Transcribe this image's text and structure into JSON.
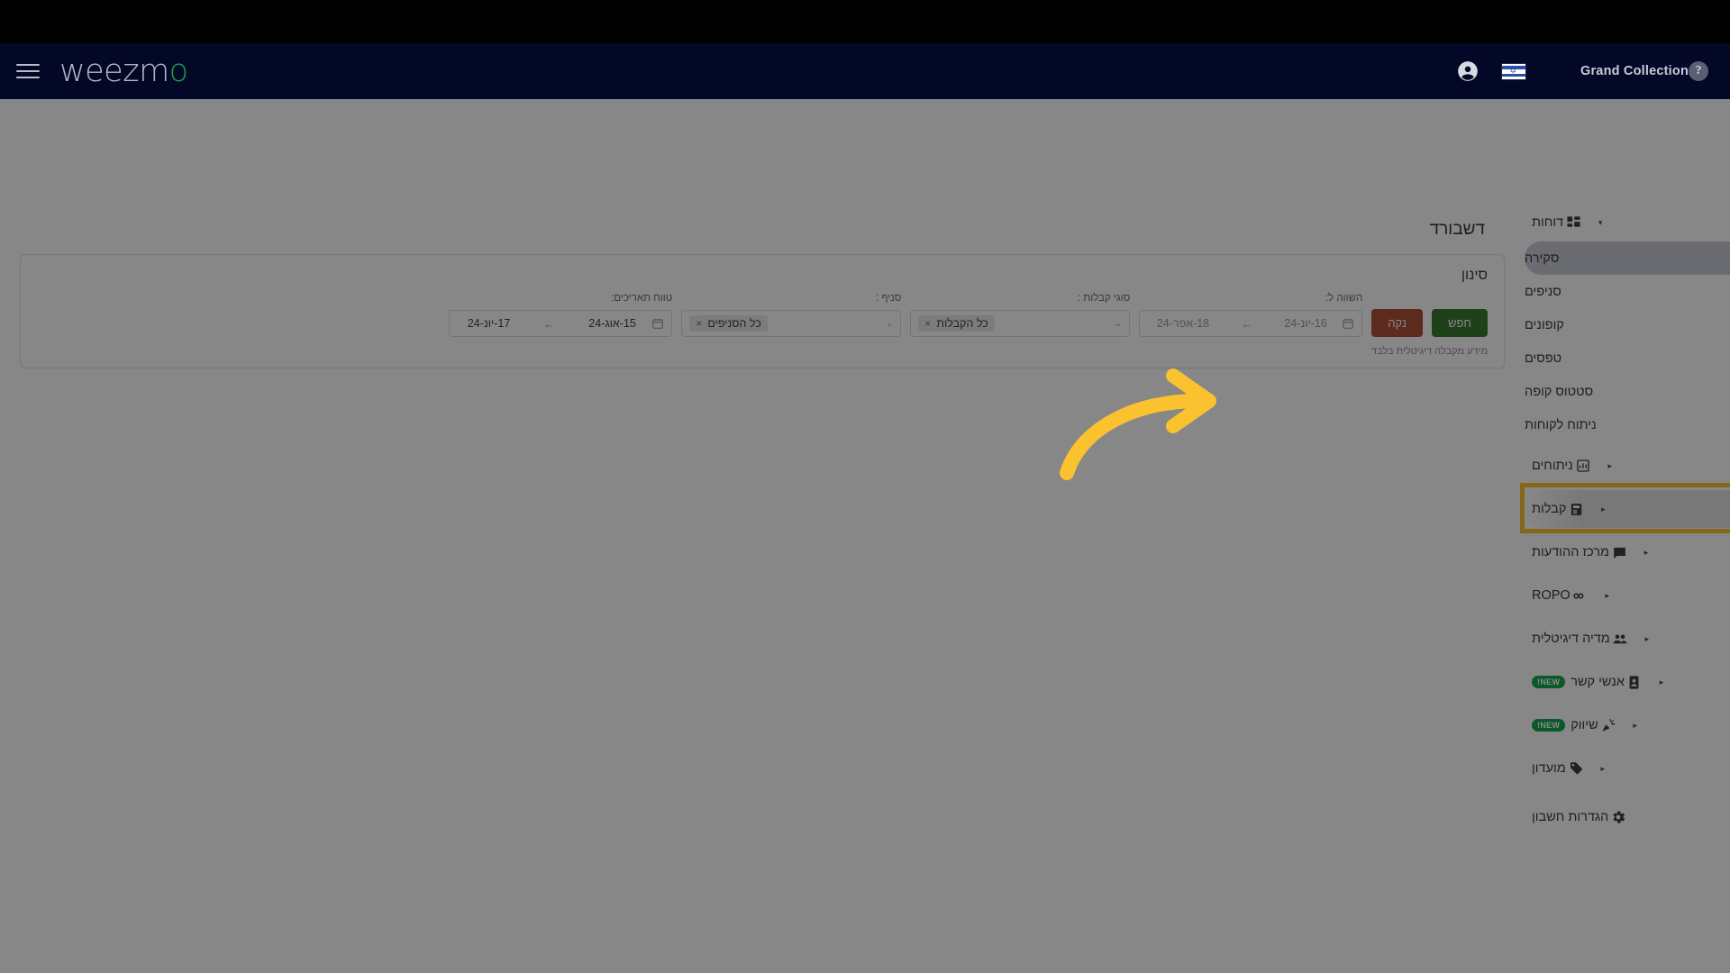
{
  "topbar": {
    "account_icon": "account-circle-icon",
    "flag": "israel-flag-icon",
    "brand_name": "Grand Collection",
    "help_icon": "help-icon",
    "menu_icon": "hamburger-menu-icon",
    "logo_text": "weezm",
    "logo_accent": "o"
  },
  "sidebar": {
    "reports": {
      "label": "דוחות",
      "icon": "dashboard-grid-icon",
      "caret": "▾"
    },
    "report_items": [
      {
        "label": "סקירה",
        "active": true
      },
      {
        "label": "סניפים",
        "active": false
      },
      {
        "label": "קופונים",
        "active": false
      },
      {
        "label": "טפסים",
        "active": false
      },
      {
        "label": "סטטוס קופה",
        "active": false
      },
      {
        "label": "ניתוח לקוחות",
        "active": false
      }
    ],
    "groups": [
      {
        "label": "ניתוחים",
        "icon": "bar-chart-icon",
        "caret": "▸",
        "badge": "",
        "highlighted": false
      },
      {
        "label": "קבלות",
        "icon": "receipt-icon",
        "caret": "▸",
        "badge": "",
        "highlighted": true
      },
      {
        "label": "מרכז ההודעות",
        "icon": "message-icon",
        "caret": "▸",
        "badge": "",
        "highlighted": false
      },
      {
        "label": "ROPO",
        "icon": "infinity-icon",
        "caret": "▸",
        "badge": "",
        "highlighted": false
      },
      {
        "label": "מדיה דיגיטלית",
        "icon": "people-icon",
        "caret": "▸",
        "badge": "",
        "highlighted": false
      },
      {
        "label": "אנשי קשר",
        "icon": "contacts-icon",
        "caret": "▸",
        "badge": "NEW!",
        "highlighted": false
      },
      {
        "label": "שיווק",
        "icon": "megaphone-icon",
        "caret": "▸",
        "badge": "NEW!",
        "highlighted": false
      },
      {
        "label": "מועדון",
        "icon": "tag-icon",
        "caret": "▸",
        "badge": "",
        "highlighted": false
      }
    ],
    "settings": {
      "label": "הגדרות חשבון",
      "icon": "gear-icon"
    }
  },
  "main": {
    "page_title": "דשבורד",
    "filter_card": {
      "title": "סינון",
      "note": "מידע מקבלה דיגיטלית בלבד",
      "date_range": {
        "label": "טווח תאריכים:",
        "start": "17-יונ-24",
        "end": "15-אוג-24",
        "separator": "←",
        "icon": "calendar-icon"
      },
      "branch": {
        "label": "סניף :",
        "chip": "כל הסניפים",
        "chip_remove": "×",
        "chevron": "⌄"
      },
      "receipt_types": {
        "label": "סוגי קבלות :",
        "chip": "כל הקבלות",
        "chip_remove": "×",
        "chevron": "⌄"
      },
      "compare_to": {
        "label": "השווה ל:",
        "start": "18-אפר-24",
        "end": "16-יונ-24",
        "separator": "←",
        "icon": "calendar-icon"
      },
      "clear_button": "נקה",
      "search_button": "חפש"
    }
  },
  "annotation": {
    "arrow": "curved-arrow-right",
    "arrow_color": "#fac22e",
    "highlight_color": "#fac22e"
  }
}
